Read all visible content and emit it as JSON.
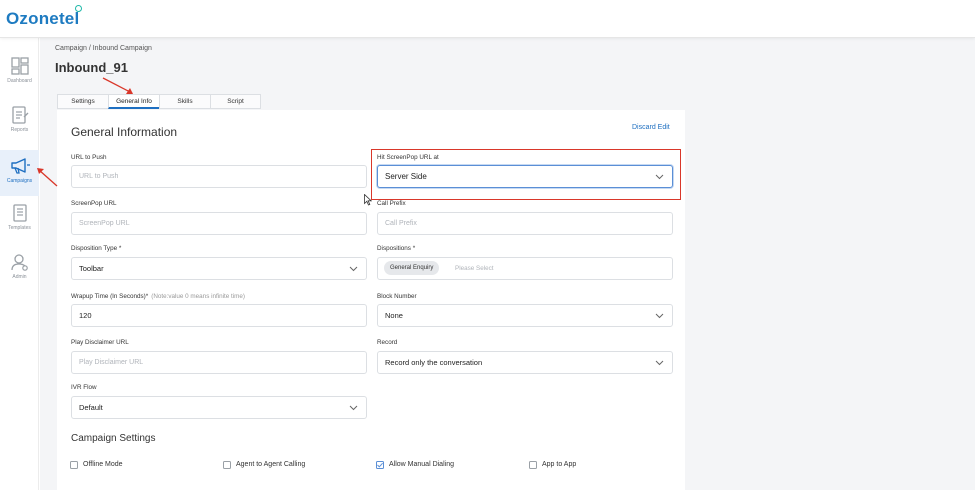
{
  "brand": {
    "name": "Ozonetel"
  },
  "sidebar": {
    "items": [
      {
        "label": "Dashboard",
        "icon": "dashboard-icon"
      },
      {
        "label": "Reports",
        "icon": "reports-icon"
      },
      {
        "label": "Campaigns",
        "icon": "megaphone-icon",
        "active": true
      },
      {
        "label": "Templates",
        "icon": "templates-icon"
      },
      {
        "label": "Admin",
        "icon": "admin-icon"
      }
    ]
  },
  "breadcrumb": "Campaign / Inbound Campaign",
  "page_title": "Inbound_91",
  "tabs": [
    "Settings",
    "General Info",
    "Skills",
    "Script"
  ],
  "form": {
    "title": "General Information",
    "discard_label": "Discard Edit",
    "url_to_push": {
      "label": "URL to Push",
      "placeholder": "URL to Push"
    },
    "hit_screenpop": {
      "label": "Hit ScreenPop URL at",
      "value": "Server Side"
    },
    "screenpop_url": {
      "label": "ScreenPop URL",
      "placeholder": "ScreenPop URL"
    },
    "call_prefix": {
      "label": "Call Prefix",
      "placeholder": "Call Prefix"
    },
    "disposition_type": {
      "label": "Disposition Type *",
      "value": "Toolbar"
    },
    "dispositions": {
      "label": "Dispositions *",
      "chip": "General Enquiry",
      "placeholder": "Please Select"
    },
    "wrapup": {
      "label": "Wrapup Time (In Seconds)*",
      "hint": "(Note:value 0 means infinite time)",
      "value": "120"
    },
    "block_number": {
      "label": "Block Number",
      "value": "None"
    },
    "play_disclaimer": {
      "label": "Play Disclaimer URL",
      "placeholder": "Play Disclaimer URL"
    },
    "record": {
      "label": "Record",
      "value": "Record only the conversation"
    },
    "ivr_flow": {
      "label": "IVR Flow",
      "value": "Default"
    }
  },
  "campaign_settings": {
    "title": "Campaign Settings",
    "options": [
      {
        "label": "Offline Mode",
        "checked": false
      },
      {
        "label": "Agent to Agent Calling",
        "checked": false
      },
      {
        "label": "Allow Manual Dialing",
        "checked": true
      },
      {
        "label": "App to App",
        "checked": false
      }
    ]
  },
  "colors": {
    "accent": "#1e6fc1",
    "annotation": "#d9372a",
    "brand": "#1e7bc1"
  }
}
